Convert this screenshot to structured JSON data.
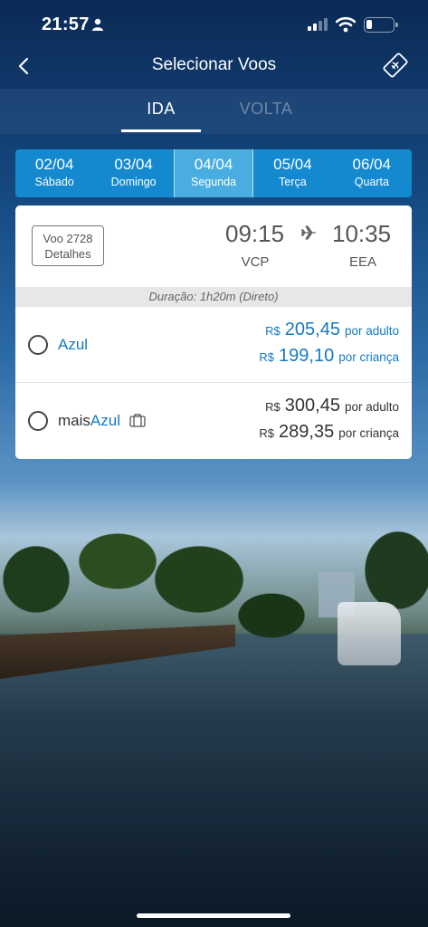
{
  "status": {
    "time": "21:57"
  },
  "nav": {
    "title": "Selecionar Voos"
  },
  "tabs": [
    {
      "label": "IDA"
    },
    {
      "label": "VOLTA"
    }
  ],
  "dates": [
    {
      "date": "02/04",
      "weekday": "Sábado"
    },
    {
      "date": "03/04",
      "weekday": "Domingo"
    },
    {
      "date": "04/04",
      "weekday": "Segunda"
    },
    {
      "date": "05/04",
      "weekday": "Terça"
    },
    {
      "date": "06/04",
      "weekday": "Quarta"
    }
  ],
  "flight": {
    "voo_line1": "Voo 2728",
    "voo_line2": "Detalhes",
    "departure_time": "09:15",
    "arrival_time": "10:35",
    "departure_code": "VCP",
    "arrival_code": "EEA",
    "duration": "Duração: 1h20m (Direto)"
  },
  "fares": [
    {
      "name": "Azul",
      "adult": {
        "currency": "R$",
        "value": "205,45",
        "label": "por adulto"
      },
      "child": {
        "currency": "R$",
        "value": "199,10",
        "label": "por criança"
      }
    },
    {
      "name_prefix": "mais",
      "name_suffix": "Azul",
      "adult": {
        "currency": "R$",
        "value": "300,45",
        "label": "por adulto"
      },
      "child": {
        "currency": "R$",
        "value": "289,35",
        "label": "por criança"
      }
    }
  ],
  "colors": {
    "accent": "#1479c4",
    "date_strip": "#1489cf",
    "date_selected": "#49aedf"
  }
}
